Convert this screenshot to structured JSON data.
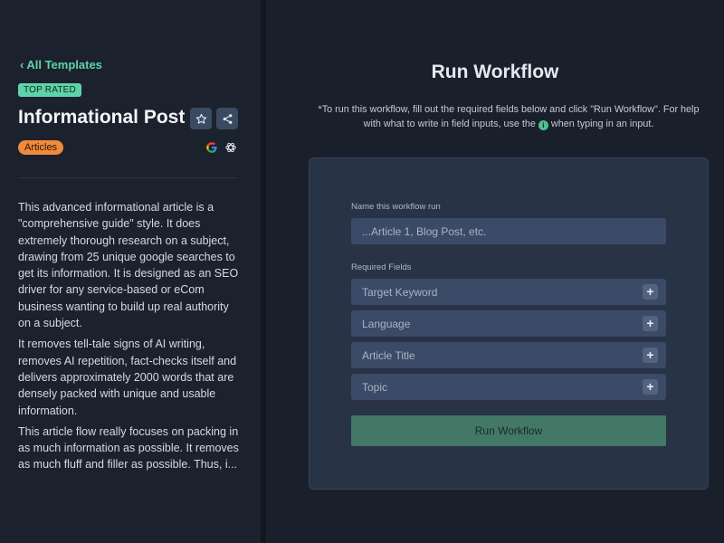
{
  "sidebar": {
    "back_label": "All Templates",
    "badge": "TOP RATED",
    "title": "Informational Post",
    "category": "Articles",
    "description": [
      "This advanced informational article is a \"comprehensive guide\" style. It does extremely thorough research on a subject, drawing from 25 unique google searches to get its information. It is designed as an SEO driver for any service-based or eCom business wanting to build up real authority on a subject.",
      "It removes tell-tale signs of AI writing, removes AI repetition, fact-checks itself and delivers approximately 2000 words that are densely packed with unique and usable information.",
      "This article flow really focuses on packing in as much information as possible. It removes as much fluff and filler as possible. Thus, i..."
    ],
    "colors": {
      "accent": "#5fd3a8",
      "category": "#f08a3c"
    }
  },
  "main": {
    "title": "Run Workflow",
    "instructions_pre": "*To run this workflow, fill out the required fields below and click \"Run Workflow\". For help with what to write in field inputs, use the",
    "instructions_post": "when typing in an input.",
    "info_glyph": "i",
    "form": {
      "name_label": "Name this workflow run",
      "name_placeholder": "...Article 1, Blog Post, etc.",
      "required_label": "Required Fields",
      "fields": [
        "Target Keyword",
        "Language",
        "Article Title",
        "Topic"
      ],
      "plus_glyph": "+",
      "submit_label": "Run Workflow"
    }
  }
}
